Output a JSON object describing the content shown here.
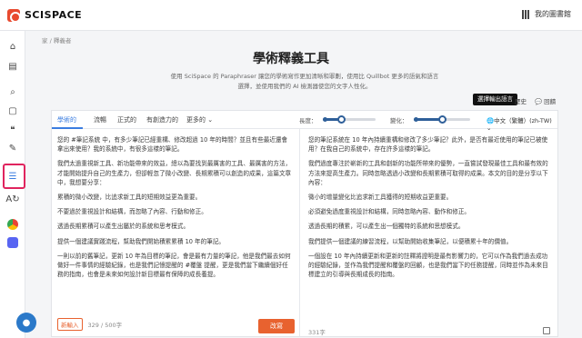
{
  "app": {
    "logo_text": "SCISPACE"
  },
  "header": {
    "library_label": "我的圖書館"
  },
  "breadcrumb": "家 / 釋義者",
  "page": {
    "title": "學術釋義工具",
    "description": "使用 SciSpace 的 Paraphraser 讓您的學術寫作更加清晰和罪劃，使用比 Quillbot 更多的語氣和語言選擇，並使用我們的 AI 檢測器使您的文字人性化。"
  },
  "tooltip": "選擇輸出語言",
  "toolbar_right": {
    "history": "歷史",
    "feedback": "回饋"
  },
  "modes": [
    "學術的",
    "流暢",
    "正式的",
    "有創造力的",
    "更多的 ⌄"
  ],
  "sliders": {
    "length_label": "長度：",
    "change_label": "變化：",
    "length_level": 0.35,
    "change_level": 0.5
  },
  "language": "中文（繁體）(zh-TW) ⌄",
  "input_paragraphs": [
    "您的 #筆記系統 中，有多少筆記已經重構、修改超過 10 年的時間？並且有些最近還會拿出來使用？我的系統中，有很多這樣的筆記。",
    "我們太過重視新工具、新功能帶來的效益，總以為要找到最厲害的工具、最厲害的方法，才能開始提升自己的生產力，但卻輕忽了微小改變、長期累積可以創造的成果，這篇文章中，我想要分享：",
    "累積的微小改變，比追求新工具的短期效益更為重要。",
    "不要過於重視設計和結構，而忽略了內容、行動和修正。",
    "透過長期累積可以產生出屬於的系統和思考模式。",
    "提供一個建議實踐流程，幫助我們開始積累累積 10 年的筆記。",
    "一則以前的舊筆記，更新 10 年為目標的筆記，會是最有力量的筆記，他是我們最去如何做好一件事情的經驗紀錄，也是我們記憶提醒的 #覆盤 提醒，更是我們當下繼續個好任務的指南，也會是未來如何設計新目標最有保障的成長養提。"
  ],
  "output_paragraphs": [
    "您的筆記系統在 10 年內持續重構和修改了多少筆記？此外，是否有最近使用的筆記已被使用？在我自己的系統中，存在許多這樣的筆記。",
    "我們過度專注於嶄新的工具和創新的功能所帶來的優勢，一直嘗試發現最佳工具和最有效的方法來提高生產力。同時忽略透過小改變和長期累積可取得的成果。本文的目的是分享以下內容：",
    "微小的增量變化比追求新工具獲得的短期收益更重要。",
    "必須避免過度重視設計和結構，同時忽略內容、動作和修正。",
    "透過長期的積累，可以產生出一個獨特的系統和思想模式。",
    "我們提供一個建議的練習流程，以幫助開始收集筆記，以便積累十年的價值。",
    "一個設在 10 年內持續更新和更新的註釋將證明是最有影響力的，它可以作為我們過去成功的經驗紀錄，並作為我們提醒和覆盤的回顧，也是我們當下的任務提醒，同時並作為未來目標建立的引導與長期成長的指南。"
  ],
  "footer": {
    "tag": "新輸入",
    "char_count": "329 / 500字",
    "rewrite_button": "改寫",
    "word_count": "331字"
  }
}
